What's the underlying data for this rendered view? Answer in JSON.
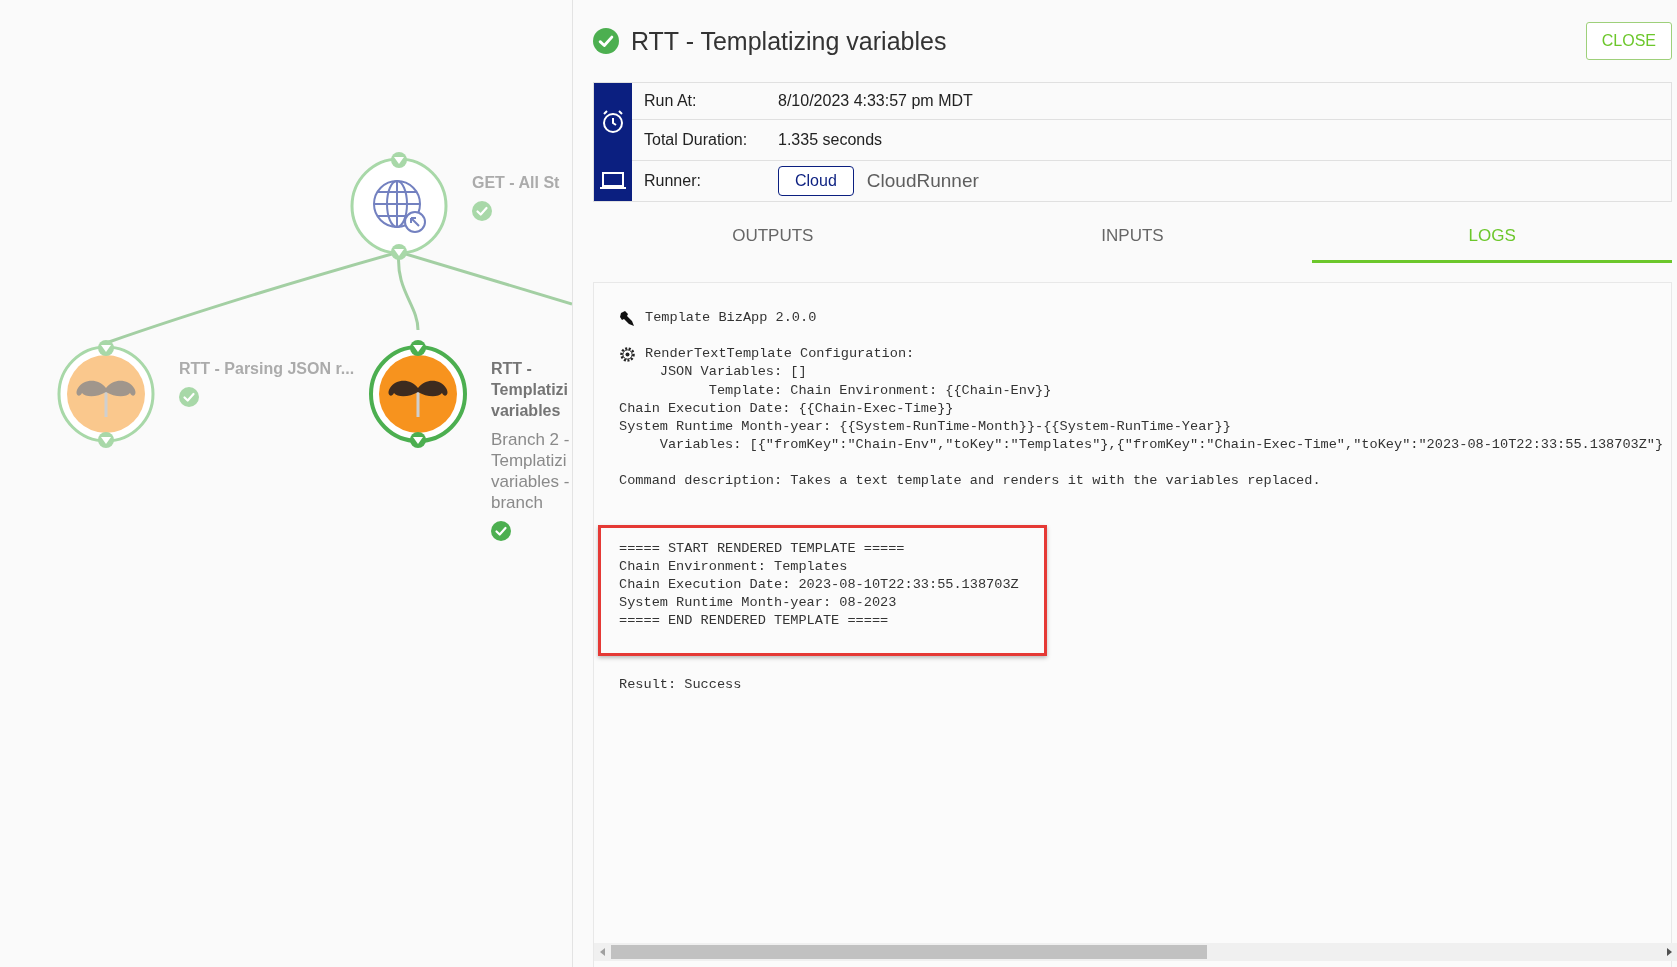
{
  "canvas": {
    "nodes": [
      {
        "kind": "http",
        "selected": false,
        "succeeded": true,
        "title_lines": [
          "GET - All St"
        ]
      },
      {
        "kind": "template",
        "selected": false,
        "succeeded": true,
        "title_lines": [
          "RTT - Parsing JSON r..."
        ]
      },
      {
        "kind": "template",
        "selected": true,
        "succeeded": true,
        "title_lines": [
          "RTT -",
          "Templatizi",
          "variables"
        ],
        "subtitle_lines": [
          "Branch 2 -",
          "Templatizi",
          "variables -",
          "branch"
        ]
      }
    ]
  },
  "panel": {
    "succeeded": true,
    "title": "RTT - Templatizing variables",
    "close_button": "CLOSE",
    "info": [
      {
        "label": "Run At:",
        "value": "8/10/2023 4:33:57 pm MDT"
      },
      {
        "label": "Total Duration:",
        "value": "1.335 seconds"
      },
      {
        "label": "Runner:",
        "badge": "Cloud",
        "value": "CloudRunner"
      }
    ],
    "tabs": [
      {
        "label": "OUTPUTS",
        "selected": false
      },
      {
        "label": "INPUTS",
        "selected": false
      },
      {
        "label": "LOGS",
        "selected": true
      }
    ],
    "log": [
      {
        "kind": "plugin",
        "lines": [
          "Template BizApp 2.0.0"
        ]
      },
      {
        "kind": "settings",
        "lines": [
          "RenderTextTemplate Configuration:",
          "     JSON Variables: []",
          "           Template: Chain Environment: {{Chain-Env}}",
          "Chain Execution Date: {{Chain-Exec-Time}}",
          "System Runtime Month-year: {{System-RunTime-Month}}-{{System-RunTime-Year}}",
          "     Variables: [{\"fromKey\":\"Chain-Env\",\"toKey\":\"Templates\"},{\"fromKey\":\"Chain-Exec-Time\",\"toKey\":\"2023-08-10T22:33:55.138703Z\"}"
        ]
      },
      {
        "kind": "text",
        "lines": [
          "Command description: Takes a text template and renders it with the variables replaced."
        ]
      },
      {
        "kind": "highlight",
        "lines": [
          "===== START RENDERED TEMPLATE =====",
          "Chain Environment: Templates",
          "Chain Execution Date: 2023-08-10T22:33:55.138703Z",
          "System Runtime Month-year: 08-2023",
          "===== END RENDERED TEMPLATE ====="
        ]
      },
      {
        "kind": "text",
        "lines": [
          "Result: Success"
        ]
      }
    ]
  }
}
